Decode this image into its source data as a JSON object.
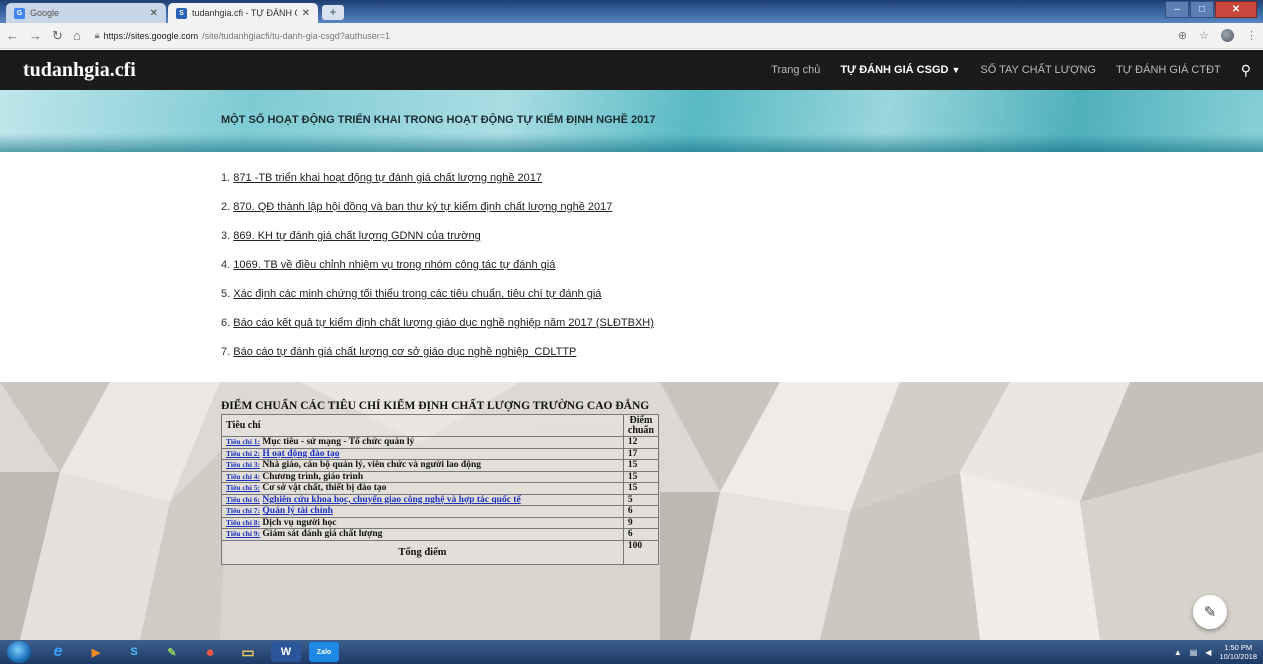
{
  "browser": {
    "tabs": [
      {
        "title": "Google",
        "favicon": "G",
        "favicon_color": "#4285f4"
      },
      {
        "title": "tudanhgia.cfi - TỰ ĐÁNH GIÁ CS",
        "favicon": "S",
        "favicon_color": "#2b63b8"
      }
    ],
    "new_tab_label": "+",
    "url_host": "https://sites.google.com",
    "url_path": "/site/tudanhgiacfi/tu-danh-gia-csgd?authuser=1"
  },
  "site": {
    "logo": "tudanhgia.cfi",
    "nav": [
      {
        "label": "Trang chủ",
        "active": false
      },
      {
        "label": "TỰ ĐÁNH GIÁ CSGD",
        "active": true
      },
      {
        "label": "SỔ TAY CHẤT LƯỢNG",
        "active": false
      },
      {
        "label": "TỰ ĐÁNH GIÁ CTĐT",
        "active": false
      }
    ]
  },
  "banner": {
    "title": "MỘT SỐ HOẠT ĐỘNG TRIỂN KHAI TRONG HOẠT ĐỘNG TỰ KIỂM ĐỊNH NGHỀ 2017"
  },
  "documents": [
    {
      "num": "1.",
      "text": "871 -TB triển khai hoạt động tự đánh giá chất lượng nghề 2017"
    },
    {
      "num": "2.",
      "text": "870. QĐ thành lập hội đồng và ban thư ký tự kiểm định chất lượng nghề 2017"
    },
    {
      "num": "3.",
      "text": "869. KH tự đánh giá chất lượng GDNN của trường"
    },
    {
      "num": "4.",
      "text": "1069. TB về điều chỉnh nhiệm vụ trong nhóm công tác tự đánh giá"
    },
    {
      "num": "5.",
      "text": "Xác định các minh chứng tối thiểu trong các tiêu chuẩn, tiêu chí tự đánh giá"
    },
    {
      "num": "6.",
      "text": "Báo cáo kết quả tự kiểm định chất lượng giáo dục nghề nghiệp năm 2017 (SLĐTBXH)"
    },
    {
      "num": "7.",
      "text": "Báo cáo tự đánh giá chất lượng cơ sở giáo dục nghề nghiệp_CDLTTP"
    }
  ],
  "score_table": {
    "title": "ĐIỂM CHUẨN CÁC TIÊU CHÍ KIỂM ĐỊNH CHẤT LƯỢNG TRƯỜNG CAO ĐẲNG",
    "header_criterion": "Tiêu chí",
    "header_points_1": "Điểm",
    "header_points_2": "chuẩn",
    "rows": [
      {
        "code": "Tiêu chí 1:",
        "name": "Mục tiêu - sứ mạng - Tổ chức quản lý",
        "points": "12",
        "style": "plain"
      },
      {
        "code": "Tiêu chí 2:",
        "name": "H oạt động đào tạo",
        "points": "17",
        "style": "link"
      },
      {
        "code": "Tiêu chí 3:",
        "name": "Nhà giáo, cán bộ quản lý, viên chức và người lao động",
        "points": "15",
        "style": "plain"
      },
      {
        "code": "Tiêu chí 4:",
        "name": "Chương trình, giáo trình",
        "points": "15",
        "style": "plain"
      },
      {
        "code": "Tiêu chí 5:",
        "name": "Cơ sở vật chất, thiết bị đào tạo",
        "points": "15",
        "style": "plain"
      },
      {
        "code": "Tiêu chí 6:",
        "name": "Nghiên cứu khoa học, chuyển giao công nghệ và hợp tác quốc tế",
        "points": "5",
        "style": "link"
      },
      {
        "code": "Tiêu chí 7:",
        "name": "Quản lý tài chính",
        "points": "6",
        "style": "link"
      },
      {
        "code": "Tiêu chí 8:",
        "name": "Dịch vụ người học",
        "points": "9",
        "style": "plain"
      },
      {
        "code": "Tiêu chí 9:",
        "name": "Giám sát đánh giá chất lượng",
        "points": "6",
        "style": "plain"
      }
    ],
    "total_label": "Tổng điểm",
    "total_points": "100"
  },
  "taskbar": {
    "time": "1:50 PM",
    "date": "10/10/2018",
    "apps": [
      {
        "name": "ie",
        "glyph": "e",
        "color": "#2a8ad6"
      },
      {
        "name": "media",
        "glyph": "▶",
        "color": "#e0701c"
      },
      {
        "name": "skype",
        "glyph": "S",
        "color": "#19a9e8"
      },
      {
        "name": "paint",
        "glyph": "✎",
        "color": "#6aa83a"
      },
      {
        "name": "chrome",
        "glyph": "●",
        "color": "#dd4b39"
      },
      {
        "name": "folder",
        "glyph": "▭",
        "color": "#e8c04a"
      },
      {
        "name": "word",
        "glyph": "W",
        "color": "#2b579a"
      },
      {
        "name": "zalo",
        "glyph": "Zalo",
        "color": "#1e88e5"
      }
    ]
  }
}
